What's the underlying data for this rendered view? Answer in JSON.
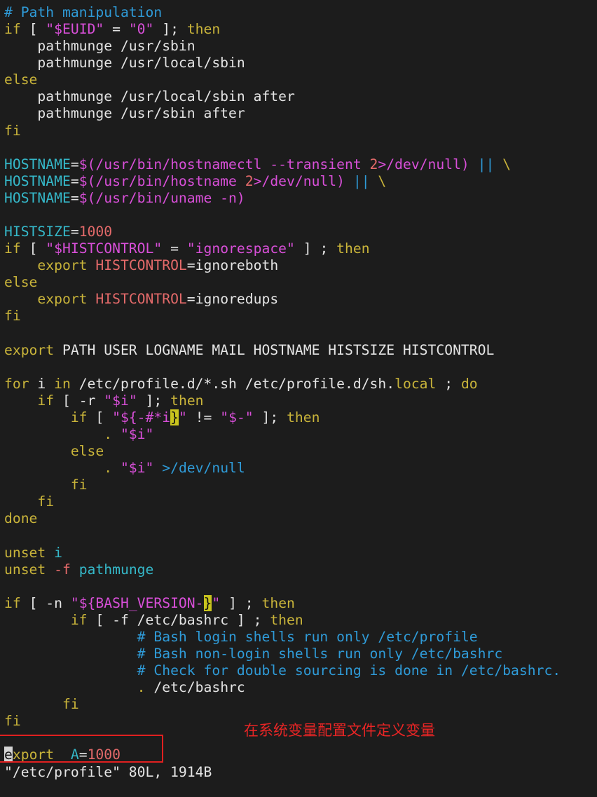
{
  "file": {
    "status_line": "\"/etc/profile\" 80L, 1914B"
  },
  "annotation": {
    "text": "在系统变量配置文件定义变量"
  },
  "colors": {
    "background": "#1c1c1c",
    "comment": "#2f9bd8",
    "keyword": "#c9b43a",
    "string": "#d84fd8",
    "number": "#e46a6a",
    "annotation_red": "#e82525"
  },
  "code": [
    [
      [
        "# Path manipulation",
        "comment"
      ]
    ],
    [
      [
        "if",
        "kw"
      ],
      [
        " [ ",
        "white"
      ],
      [
        "\"$EUID\"",
        "str"
      ],
      [
        " = ",
        "white"
      ],
      [
        "\"0\"",
        "str"
      ],
      [
        " ]; ",
        "white"
      ],
      [
        "then",
        "kw"
      ]
    ],
    [
      [
        "    pathmunge /usr/sbin",
        "white"
      ]
    ],
    [
      [
        "    pathmunge /usr/local/sbin",
        "white"
      ]
    ],
    [
      [
        "else",
        "kw"
      ]
    ],
    [
      [
        "    pathmunge /usr/local/sbin after",
        "white"
      ]
    ],
    [
      [
        "    pathmunge /usr/sbin after",
        "white"
      ]
    ],
    [
      [
        "fi",
        "kw"
      ]
    ],
    [],
    [
      [
        "HOSTNAME",
        "cyan"
      ],
      [
        "=",
        "white"
      ],
      [
        "$(/usr/bin/hostnamectl --transient ",
        "pink"
      ],
      [
        "2",
        "num"
      ],
      [
        ">/dev/null) ",
        "pink"
      ],
      [
        "||",
        "blue"
      ],
      [
        " \\",
        "kw"
      ]
    ],
    [
      [
        "HOSTNAME",
        "cyan"
      ],
      [
        "=",
        "white"
      ],
      [
        "$(/usr/bin/hostname ",
        "pink"
      ],
      [
        "2",
        "num"
      ],
      [
        ">/dev/null) ",
        "pink"
      ],
      [
        "||",
        "blue"
      ],
      [
        " \\",
        "kw"
      ]
    ],
    [
      [
        "HOSTNAME",
        "cyan"
      ],
      [
        "=",
        "white"
      ],
      [
        "$(/usr/bin/uname -n)",
        "pink"
      ]
    ],
    [],
    [
      [
        "HISTSIZE",
        "cyan"
      ],
      [
        "=",
        "white"
      ],
      [
        "1000",
        "num"
      ]
    ],
    [
      [
        "if",
        "kw"
      ],
      [
        " [ ",
        "white"
      ],
      [
        "\"$HISTCONTROL\"",
        "str"
      ],
      [
        " = ",
        "white"
      ],
      [
        "\"ignorespace\"",
        "str"
      ],
      [
        " ] ; ",
        "white"
      ],
      [
        "then",
        "kw"
      ]
    ],
    [
      [
        "    ",
        "white"
      ],
      [
        "export",
        "kw"
      ],
      [
        " ",
        "white"
      ],
      [
        "HISTCONTROL",
        "num"
      ],
      [
        "=",
        "white"
      ],
      [
        "ignoreboth",
        "white"
      ]
    ],
    [
      [
        "else",
        "kw"
      ]
    ],
    [
      [
        "    ",
        "white"
      ],
      [
        "export",
        "kw"
      ],
      [
        " ",
        "white"
      ],
      [
        "HISTCONTROL",
        "num"
      ],
      [
        "=",
        "white"
      ],
      [
        "ignoredups",
        "white"
      ]
    ],
    [
      [
        "fi",
        "kw"
      ]
    ],
    [],
    [
      [
        "export",
        "kw"
      ],
      [
        " PATH USER LOGNAME MAIL HOSTNAME HISTSIZE HISTCONTROL",
        "white"
      ]
    ],
    [],
    [
      [
        "for",
        "kw"
      ],
      [
        " i ",
        "white"
      ],
      [
        "in",
        "kw"
      ],
      [
        " /etc/profile.d/*.sh /etc/profile.d/sh.",
        "white"
      ],
      [
        "local",
        "kw"
      ],
      [
        " ; ",
        "white"
      ],
      [
        "do",
        "kw"
      ]
    ],
    [
      [
        "    ",
        "white"
      ],
      [
        "if",
        "kw"
      ],
      [
        " [ -r ",
        "white"
      ],
      [
        "\"$i\"",
        "str"
      ],
      [
        " ]; ",
        "white"
      ],
      [
        "then",
        "kw"
      ]
    ],
    [
      [
        "        ",
        "white"
      ],
      [
        "if",
        "kw"
      ],
      [
        " [ ",
        "white"
      ],
      [
        "\"${-#*i",
        "str"
      ],
      [
        "}",
        "hl"
      ],
      [
        "\"",
        "str"
      ],
      [
        " != ",
        "white"
      ],
      [
        "\"$-\"",
        "str"
      ],
      [
        " ]; ",
        "white"
      ],
      [
        "then",
        "kw"
      ]
    ],
    [
      [
        "            . ",
        "kw"
      ],
      [
        "\"$i\"",
        "str"
      ]
    ],
    [
      [
        "        ",
        "white"
      ],
      [
        "else",
        "kw"
      ]
    ],
    [
      [
        "            . ",
        "kw"
      ],
      [
        "\"$i\"",
        "str"
      ],
      [
        " ",
        "white"
      ],
      [
        ">/dev/null",
        "blue"
      ]
    ],
    [
      [
        "        ",
        "white"
      ],
      [
        "fi",
        "kw"
      ]
    ],
    [
      [
        "    ",
        "white"
      ],
      [
        "fi",
        "kw"
      ]
    ],
    [
      [
        "done",
        "kw"
      ]
    ],
    [],
    [
      [
        "unset",
        "kw"
      ],
      [
        " ",
        "white"
      ],
      [
        "i",
        "cyan"
      ]
    ],
    [
      [
        "unset",
        "kw"
      ],
      [
        " ",
        "white"
      ],
      [
        "-f",
        "num"
      ],
      [
        " ",
        "white"
      ],
      [
        "pathmunge",
        "cyan"
      ]
    ],
    [],
    [
      [
        "if",
        "kw"
      ],
      [
        " [ -n ",
        "white"
      ],
      [
        "\"${BASH_VERSION-",
        "str"
      ],
      [
        "}",
        "hl"
      ],
      [
        "\"",
        "str"
      ],
      [
        " ] ; ",
        "white"
      ],
      [
        "then",
        "kw"
      ]
    ],
    [
      [
        "        ",
        "white"
      ],
      [
        "if",
        "kw"
      ],
      [
        " [ -f /etc/bashrc ] ; ",
        "white"
      ],
      [
        "then",
        "kw"
      ]
    ],
    [
      [
        "                ",
        "white"
      ],
      [
        "# Bash login shells run only /etc/profile",
        "comment"
      ]
    ],
    [
      [
        "                ",
        "white"
      ],
      [
        "# Bash non-login shells run only /etc/bashrc",
        "comment"
      ]
    ],
    [
      [
        "                ",
        "white"
      ],
      [
        "# Check for double sourcing is done in /etc/bashrc.",
        "comment"
      ]
    ],
    [
      [
        "                ",
        "white"
      ],
      [
        ".",
        "kw"
      ],
      [
        " /etc/bashrc",
        "white"
      ]
    ],
    [
      [
        "       ",
        "white"
      ],
      [
        "fi",
        "kw"
      ]
    ],
    [
      [
        "fi",
        "kw"
      ]
    ],
    [],
    [
      [
        "e",
        "cursor"
      ],
      [
        "xport",
        "kw"
      ],
      [
        "  ",
        "white"
      ],
      [
        "A",
        "cyan"
      ],
      [
        "=",
        "white"
      ],
      [
        "1000",
        "num"
      ]
    ]
  ]
}
